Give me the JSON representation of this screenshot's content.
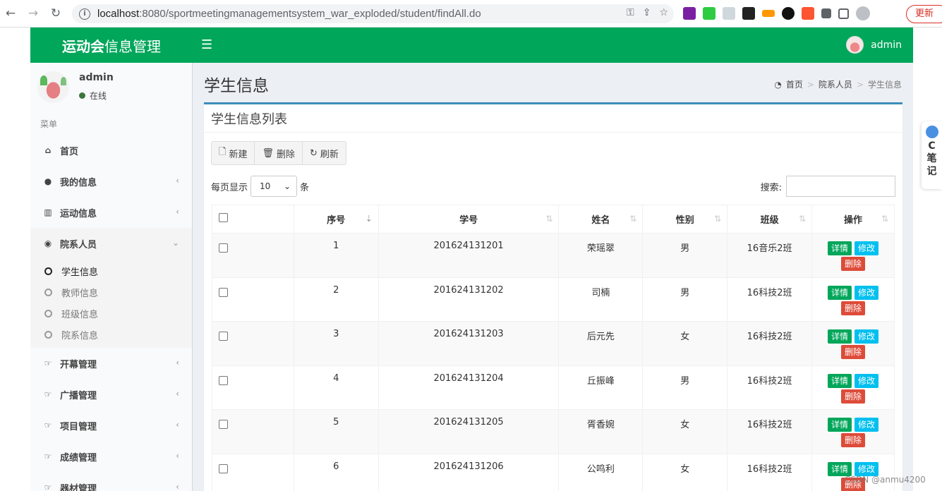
{
  "browser": {
    "url_host": "localhost",
    "url_rest": ":8080/sportmeetingmanagementsystem_war_exploded/student/findAll.do",
    "update_label": "更新"
  },
  "app": {
    "logo_bold": "运动会",
    "logo_rest": "信息管理",
    "top_username": "admin"
  },
  "sidebar": {
    "username": "admin",
    "status": "在线",
    "menu_header": "菜单",
    "items": [
      {
        "label": "首页",
        "icon": "home-icon"
      },
      {
        "label": "我的信息",
        "icon": "user-icon"
      },
      {
        "label": "运动信息",
        "icon": "bar-chart-icon"
      },
      {
        "label": "院系人员",
        "icon": "users-icon"
      },
      {
        "label": "开幕管理",
        "icon": "hand-icon"
      },
      {
        "label": "广播管理",
        "icon": "hand-icon"
      },
      {
        "label": "项目管理",
        "icon": "hand-icon"
      },
      {
        "label": "成绩管理",
        "icon": "hand-icon"
      },
      {
        "label": "器材管理",
        "icon": "hand-icon"
      }
    ],
    "subitems": [
      "学生信息",
      "教师信息",
      "班级信息",
      "院系信息"
    ]
  },
  "page": {
    "title": "学生信息",
    "breadcrumb": [
      "首页",
      "院系人员",
      "学生信息"
    ]
  },
  "box": {
    "title": "学生信息列表",
    "toolbar": {
      "new": "新建",
      "delete": "删除",
      "refresh": "刷新"
    },
    "length_prefix": "每页显示",
    "length_value": "10",
    "length_suffix": "条",
    "search_label": "搜索:"
  },
  "table": {
    "headers": [
      "序号",
      "学号",
      "姓名",
      "性别",
      "班级",
      "操作"
    ],
    "actions": {
      "detail": "详情",
      "edit": "修改",
      "delete": "删除"
    },
    "rows": [
      {
        "no": "1",
        "sid": "201624131201",
        "name": "荣瑶翠",
        "gender": "男",
        "cls": "16音乐2班"
      },
      {
        "no": "2",
        "sid": "201624131202",
        "name": "司楠",
        "gender": "男",
        "cls": "16科技2班"
      },
      {
        "no": "3",
        "sid": "201624131203",
        "name": "后元先",
        "gender": "女",
        "cls": "16科技2班"
      },
      {
        "no": "4",
        "sid": "201624131204",
        "name": "丘振峰",
        "gender": "男",
        "cls": "16科技2班"
      },
      {
        "no": "5",
        "sid": "201624131205",
        "name": "胥香婉",
        "gender": "女",
        "cls": "16科技2班"
      },
      {
        "no": "6",
        "sid": "201624131206",
        "name": "公鸣利",
        "gender": "女",
        "cls": "16科技2班"
      }
    ]
  },
  "widget": {
    "line1": "C",
    "line2": "笔",
    "line3": "记"
  },
  "watermark": "CSDN @anmu4200"
}
